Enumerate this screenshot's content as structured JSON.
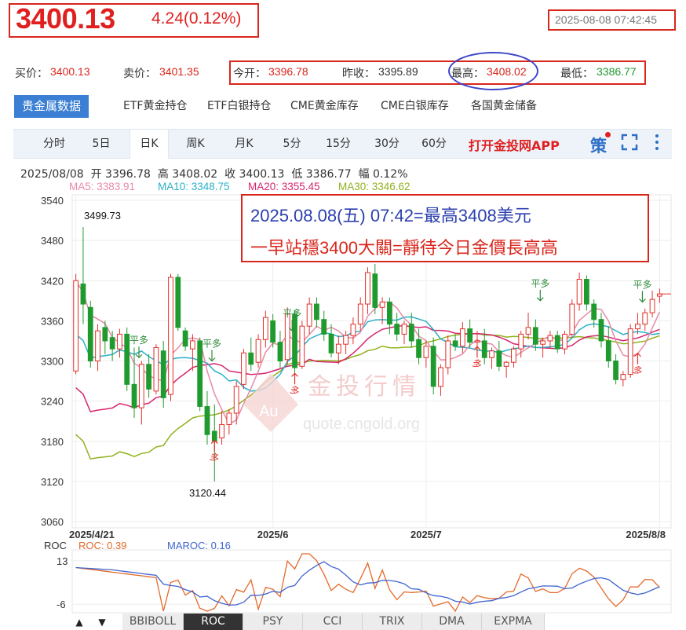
{
  "header": {
    "price": "3400.13",
    "change": "4.24(0.12%)",
    "timestamp": "2025-08-08 07:42:45"
  },
  "quote": {
    "bid_label": "买价：",
    "bid": "3400.13",
    "ask_label": "卖价：",
    "ask": "3401.35",
    "open_label": "今开：",
    "open": "3396.78",
    "prev_close_label": "昨收：",
    "prev_close": "3395.89",
    "high_label": "最高：",
    "high": "3408.02",
    "low_label": "最低：",
    "low": "3386.77"
  },
  "tabs": [
    "贵金属数据",
    "ETF黄金持仓",
    "ETF白银持仓",
    "CME黄金库存",
    "CME白银库存",
    "各国黄金储备"
  ],
  "periods": [
    "分时",
    "5日",
    "日K",
    "周K",
    "月K",
    "5分",
    "15分",
    "30分",
    "60分"
  ],
  "active_period": "日K",
  "app_link": "打开金投网APP",
  "toolbar_icons": [
    "strategy-icon",
    "fullscreen-icon",
    "more-icon"
  ],
  "ohlc_line": "2025/08/08  开 3396.78  高 3408.02  收 3400.13  低 3386.77  幅 0.12%",
  "ma_legend": [
    {
      "label": "MA5: 3383.91",
      "color": "#e88aa8"
    },
    {
      "label": "MA10: 3348.75",
      "color": "#2bb0c8"
    },
    {
      "label": "MA20: 3355.45",
      "color": "#d6246e"
    },
    {
      "label": "MA30: 3346.62",
      "color": "#8fb21e"
    }
  ],
  "annotation": {
    "line1": "2025.08.08(五) 07:42=最高3408美元",
    "line2": "一早站穩3400大關=靜待今日金價長高高"
  },
  "watermark": {
    "text": "金投行情",
    "url": "quote.cngold.org",
    "logo": "Au"
  },
  "markers": {
    "flat_long": "平多",
    "long": "多"
  },
  "chart_data": {
    "type": "candlestick",
    "y_ticks": [
      3540,
      3480,
      3420,
      3360,
      3300,
      3240,
      3180,
      3120,
      3060
    ],
    "ylim": [
      3060,
      3540
    ],
    "x_labels": [
      "2025/4/21",
      "2025/6",
      "2025/7",
      "2025/8/8"
    ],
    "max_label": "3499.73",
    "min_label": "3120.44",
    "candles": [
      [
        3285,
        3430,
        3280,
        3420
      ],
      [
        3415,
        3500,
        3355,
        3385
      ],
      [
        3380,
        3390,
        3290,
        3300
      ],
      [
        3300,
        3355,
        3285,
        3345
      ],
      [
        3350,
        3360,
        3310,
        3330
      ],
      [
        3335,
        3345,
        3300,
        3318
      ],
      [
        3318,
        3348,
        3305,
        3340
      ],
      [
        3340,
        3350,
        3255,
        3265
      ],
      [
        3265,
        3320,
        3215,
        3230
      ],
      [
        3230,
        3300,
        3205,
        3295
      ],
      [
        3295,
        3310,
        3245,
        3258
      ],
      [
        3255,
        3325,
        3250,
        3320
      ],
      [
        3315,
        3330,
        3230,
        3245
      ],
      [
        3250,
        3430,
        3240,
        3425
      ],
      [
        3425,
        3430,
        3345,
        3350
      ],
      [
        3345,
        3350,
        3315,
        3322
      ],
      [
        3318,
        3340,
        3285,
        3330
      ],
      [
        3330,
        3335,
        3225,
        3232
      ],
      [
        3232,
        3255,
        3175,
        3190
      ],
      [
        3195,
        3235,
        3120,
        3180
      ],
      [
        3185,
        3225,
        3175,
        3205
      ],
      [
        3205,
        3228,
        3190,
        3222
      ],
      [
        3222,
        3270,
        3205,
        3262
      ],
      [
        3265,
        3318,
        3258,
        3312
      ],
      [
        3312,
        3335,
        3285,
        3295
      ],
      [
        3298,
        3340,
        3290,
        3332
      ],
      [
        3332,
        3375,
        3320,
        3365
      ],
      [
        3360,
        3370,
        3320,
        3328
      ],
      [
        3328,
        3345,
        3290,
        3300
      ],
      [
        3302,
        3380,
        3295,
        3370
      ],
      [
        3370,
        3375,
        3280,
        3290
      ],
      [
        3292,
        3360,
        3288,
        3352
      ],
      [
        3352,
        3395,
        3340,
        3385
      ],
      [
        3385,
        3395,
        3350,
        3362
      ],
      [
        3362,
        3375,
        3330,
        3340
      ],
      [
        3340,
        3355,
        3305,
        3312
      ],
      [
        3312,
        3338,
        3295,
        3325
      ],
      [
        3325,
        3345,
        3310,
        3338
      ],
      [
        3338,
        3365,
        3325,
        3355
      ],
      [
        3355,
        3395,
        3345,
        3385
      ],
      [
        3385,
        3440,
        3370,
        3432
      ],
      [
        3430,
        3445,
        3370,
        3380
      ],
      [
        3380,
        3395,
        3355,
        3388
      ],
      [
        3388,
        3395,
        3340,
        3355
      ],
      [
        3355,
        3372,
        3330,
        3340
      ],
      [
        3340,
        3360,
        3325,
        3355
      ],
      [
        3355,
        3372,
        3320,
        3330
      ],
      [
        3332,
        3348,
        3295,
        3305
      ],
      [
        3305,
        3330,
        3290,
        3322
      ],
      [
        3322,
        3335,
        3250,
        3262
      ],
      [
        3262,
        3295,
        3248,
        3290
      ],
      [
        3290,
        3338,
        3280,
        3330
      ],
      [
        3330,
        3340,
        3315,
        3322
      ],
      [
        3322,
        3358,
        3312,
        3348
      ],
      [
        3348,
        3362,
        3320,
        3328
      ],
      [
        3328,
        3345,
        3315,
        3330
      ],
      [
        3330,
        3348,
        3295,
        3305
      ],
      [
        3305,
        3320,
        3288,
        3315
      ],
      [
        3315,
        3330,
        3285,
        3292
      ],
      [
        3292,
        3300,
        3275,
        3298
      ],
      [
        3298,
        3322,
        3290,
        3318
      ],
      [
        3318,
        3345,
        3305,
        3340
      ],
      [
        3340,
        3372,
        3332,
        3350
      ],
      [
        3350,
        3362,
        3315,
        3325
      ],
      [
        3325,
        3335,
        3305,
        3330
      ],
      [
        3330,
        3345,
        3320,
        3338
      ],
      [
        3338,
        3345,
        3312,
        3318
      ],
      [
        3318,
        3345,
        3310,
        3340
      ],
      [
        3340,
        3392,
        3335,
        3385
      ],
      [
        3385,
        3432,
        3375,
        3422
      ],
      [
        3422,
        3428,
        3375,
        3385
      ],
      [
        3385,
        3392,
        3350,
        3362
      ],
      [
        3362,
        3372,
        3320,
        3330
      ],
      [
        3330,
        3352,
        3290,
        3300
      ],
      [
        3300,
        3310,
        3265,
        3272
      ],
      [
        3272,
        3285,
        3262,
        3280
      ],
      [
        3280,
        3355,
        3275,
        3348
      ],
      [
        3348,
        3372,
        3340,
        3355
      ],
      [
        3355,
        3378,
        3345,
        3372
      ],
      [
        3372,
        3405,
        3365,
        3392
      ],
      [
        3396.78,
        3408.02,
        3386.77,
        3400.13
      ]
    ],
    "roc_label": "ROC",
    "roc_legend": [
      {
        "label": "ROC: 0.39",
        "color": "#e4692a"
      },
      {
        "label": "MAROC: 0.16",
        "color": "#3f64d0"
      }
    ],
    "roc_ticks": [
      13,
      -6
    ],
    "roc_ylim": [
      -9,
      16
    ]
  },
  "indicator_tabs": [
    "BBIBOLL",
    "ROC",
    "PSY",
    "CCI",
    "TRIX",
    "DMA",
    "EXPMA"
  ],
  "active_indicator": "ROC"
}
